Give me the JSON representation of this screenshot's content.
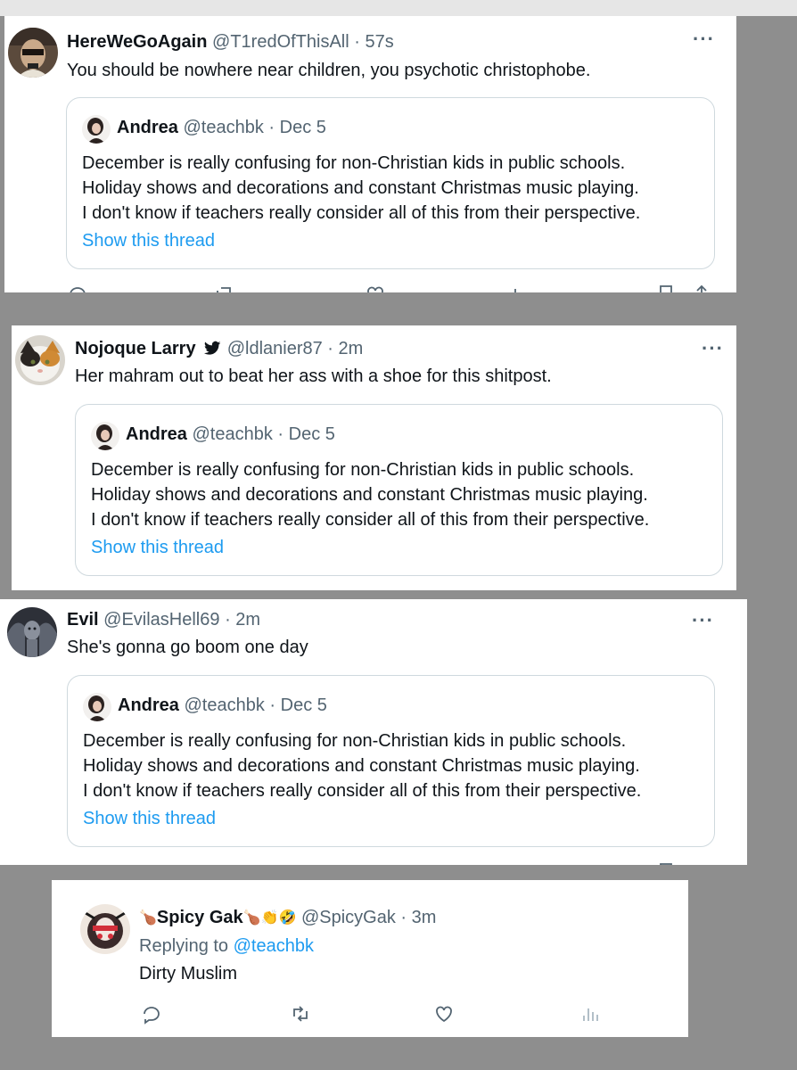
{
  "tweets": [
    {
      "display_name": "HereWeGoAgain",
      "handle": "@T1redOfThisAll",
      "sep": "·",
      "time": "57s",
      "text": "You should be nowhere near children, you psychotic christophobe."
    },
    {
      "display_name": "Nojoque Larry",
      "handle": "@ldlanier87",
      "sep": "·",
      "time": "2m",
      "text": "Her mahram out to beat her ass with a shoe for this shitpost."
    },
    {
      "display_name": "Evil",
      "handle": "@EvilasHell69",
      "sep": "·",
      "time": "2m",
      "text": "She's gonna go boom one day"
    }
  ],
  "quoted": {
    "display_name": "Andrea",
    "handle": "@teachbk",
    "sep": "·",
    "date": "Dec 5",
    "lines": [
      "December is really confusing for non-Christian kids in public schools.",
      "Holiday shows and decorations and constant Christmas music playing.",
      "I don't know if teachers really consider all of this from their perspective."
    ],
    "show_thread": "Show this thread"
  },
  "reply": {
    "display_name": "Spicy Gak",
    "handle": "@SpicyGak",
    "sep": "·",
    "time": "3m",
    "replying_prefix": "Replying to",
    "replying_to": "@teachbk",
    "text": "Dirty Muslim",
    "emoji_prefix": "🍗",
    "emoji_suffix": [
      "🍗",
      "👏",
      "🤣"
    ]
  },
  "menu_icon": "more-dots-icon",
  "colors": {
    "link": "#1d9bf0",
    "muted": "#536471",
    "text": "#0f1419",
    "border": "#cfd9de",
    "backdrop": "#8e8e8e"
  }
}
